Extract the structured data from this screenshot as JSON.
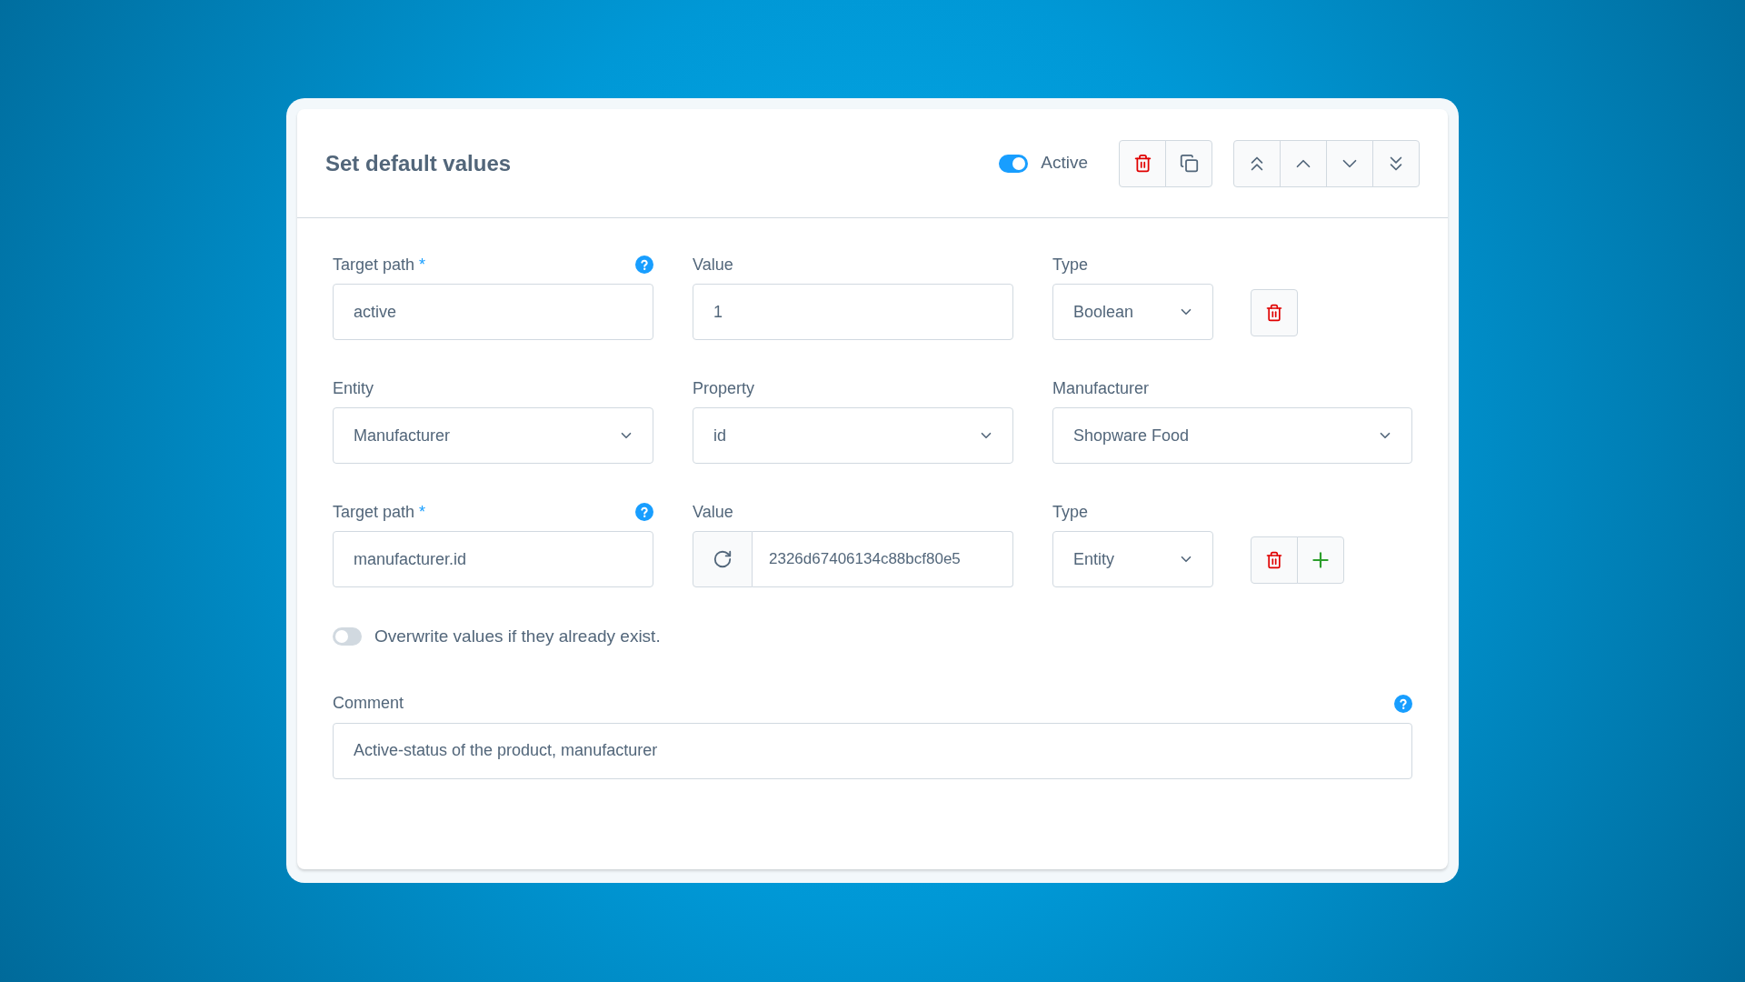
{
  "panel": {
    "title": "Set default values",
    "active_toggle": {
      "label": "Active",
      "on": true
    }
  },
  "rows": [
    {
      "fields": [
        {
          "kind": "input",
          "label": "Target path",
          "required_mark": "*",
          "help": true,
          "value": "active"
        },
        {
          "kind": "input",
          "label": "Value",
          "value": "1"
        },
        {
          "kind": "select",
          "label": "Type",
          "value": "Boolean"
        }
      ],
      "actions": [
        {
          "kind": "delete"
        }
      ]
    },
    {
      "fields": [
        {
          "kind": "select",
          "label": "Entity",
          "value": "Manufacturer"
        },
        {
          "kind": "select",
          "label": "Property",
          "value": "id"
        },
        {
          "kind": "select",
          "label": "Manufacturer",
          "value": "Shopware Food"
        }
      ],
      "actions": []
    },
    {
      "fields": [
        {
          "kind": "input",
          "label": "Target path",
          "required_mark": "*",
          "help": true,
          "value": "manufacturer.id"
        },
        {
          "kind": "refresh-input",
          "label": "Value",
          "value": "2326d67406134c88bcf80e5"
        },
        {
          "kind": "select",
          "label": "Type",
          "value": "Entity"
        }
      ],
      "actions": [
        {
          "kind": "delete"
        },
        {
          "kind": "add"
        }
      ]
    }
  ],
  "overwrite_toggle": {
    "label": "Overwrite values if they already exist.",
    "on": false
  },
  "comment": {
    "label": "Comment",
    "help": true,
    "value": "Active-status of the product, manufacturer"
  }
}
